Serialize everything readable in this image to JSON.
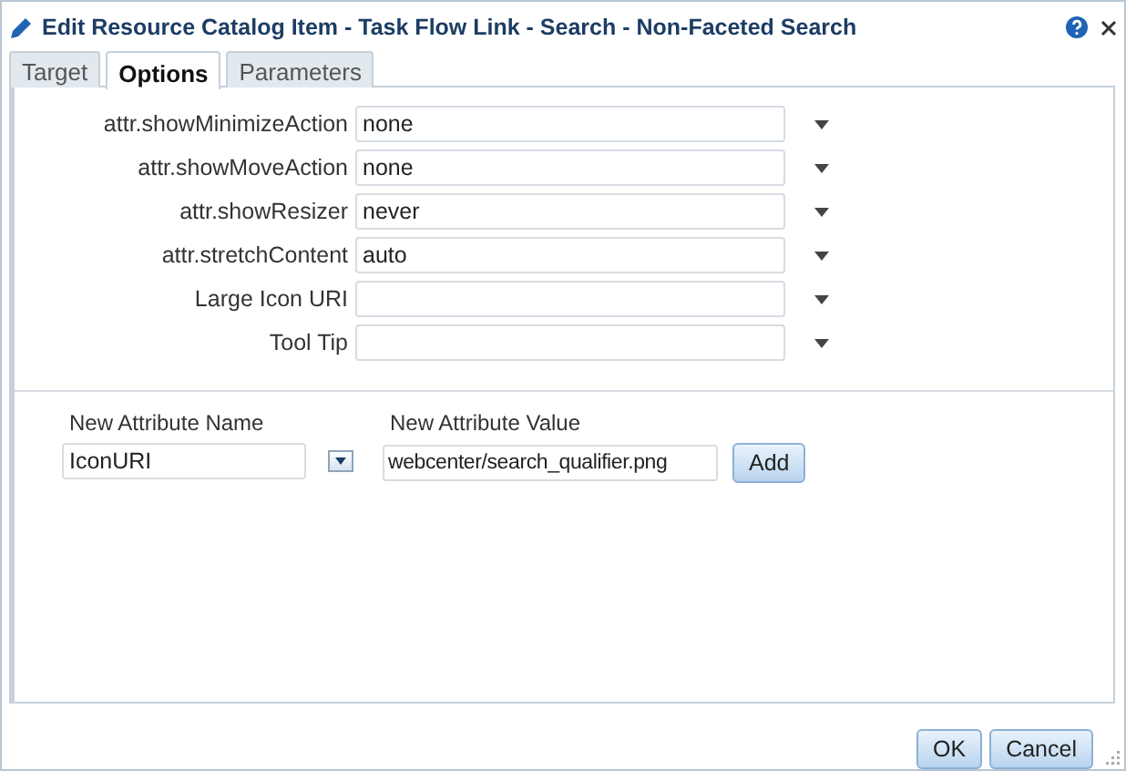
{
  "window": {
    "title": "Edit Resource Catalog Item - Task Flow Link - Search - Non-Faceted Search"
  },
  "tabs": [
    {
      "label": "Target",
      "selected": false
    },
    {
      "label": "Options",
      "selected": true
    },
    {
      "label": "Parameters",
      "selected": false
    }
  ],
  "options": [
    {
      "label": "attr.showMinimizeAction",
      "value": "none"
    },
    {
      "label": "attr.showMoveAction",
      "value": "none"
    },
    {
      "label": "attr.showResizer",
      "value": "never"
    },
    {
      "label": "attr.stretchContent",
      "value": "auto"
    },
    {
      "label": "Large Icon URI"
    },
    {
      "label": "Tool Tip"
    }
  ],
  "new_attribute": {
    "name_label": "New Attribute Name",
    "name_value": "IconURI",
    "value_label": "New Attribute Value",
    "value_value": "webcenter/search_qualifier.png",
    "add_button": "Add"
  },
  "buttons": [
    "OK",
    "Cancel"
  ]
}
